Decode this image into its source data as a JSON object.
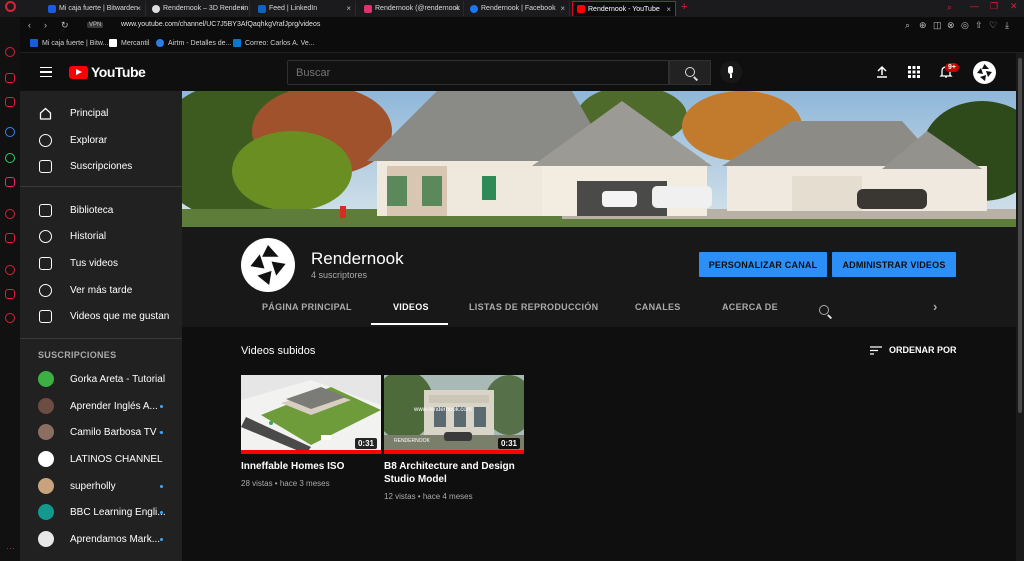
{
  "browser": {
    "tabs": [
      {
        "label": "Mi caja fuerte | Bitwarden",
        "fav_color": "#175ddc"
      },
      {
        "label": "Rendernook – 3D Renderin",
        "fav_color": "#dddddd"
      },
      {
        "label": "Feed | LinkedIn",
        "fav_color": "#0a66c2"
      },
      {
        "label": "Rendernook (@rendernook",
        "fav_color": "#e1306c"
      },
      {
        "label": "Rendernook | Facebook",
        "fav_color": "#1877f2"
      },
      {
        "label": "Rendernook - YouTube",
        "fav_color": "#ff0000"
      }
    ],
    "url": "www.youtube.com/channel/UC7J5BY3AfQaqhkgVrafJprg/videos",
    "vpn_label": "VPN",
    "bookmarks": [
      {
        "label": "Mi caja fuerte | Bitw...",
        "fav_color": "#175ddc"
      },
      {
        "label": "Mercantil",
        "fav_color": "#ffffff"
      },
      {
        "label": "Airtm - Detalles de...",
        "fav_color": "#2d7be5"
      },
      {
        "label": "Correo: Carlos A. Ve...",
        "fav_color": "#0078d4"
      }
    ]
  },
  "header": {
    "logo_text": "YouTube",
    "search_placeholder": "Buscar",
    "notifications_badge": "9+"
  },
  "guide": {
    "main_items": [
      {
        "label": "Principal",
        "icon": "home-icon"
      },
      {
        "label": "Explorar",
        "icon": "compass-icon"
      },
      {
        "label": "Suscripciones",
        "icon": "subscriptions-icon"
      }
    ],
    "library_items": [
      {
        "label": "Biblioteca",
        "icon": "library-icon"
      },
      {
        "label": "Historial",
        "icon": "history-icon"
      },
      {
        "label": "Tus videos",
        "icon": "your-videos-icon"
      },
      {
        "label": "Ver más tarde",
        "icon": "clock-icon"
      },
      {
        "label": "Videos que me gustan",
        "icon": "thumbs-up-icon"
      }
    ],
    "subscriptions_title": "SUSCRIPCIONES",
    "subscriptions": [
      {
        "label": "Gorka Areta - Tutorial...",
        "color": "#3cb043",
        "dot": false
      },
      {
        "label": "Aprender Inglés A...",
        "color": "#6d4c41",
        "dot": true
      },
      {
        "label": "Camilo Barbosa TV - I...",
        "color": "#8d6e63",
        "dot": true
      },
      {
        "label": "LATINOS CHANNEL",
        "color": "#ffffff",
        "dot": false
      },
      {
        "label": "superholly",
        "color": "#c9a27e",
        "dot": true
      },
      {
        "label": "BBC Learning Engli...",
        "color": "#139a8f",
        "dot": true
      },
      {
        "label": "Aprendamos Mark...",
        "color": "#e8e8e8",
        "dot": true
      }
    ]
  },
  "channel": {
    "name": "Rendernook",
    "subscribers": "4 suscriptores",
    "customize_button": "PERSONALIZAR CANAL",
    "manage_button": "ADMINISTRAR VIDEOS",
    "tabs": [
      "PÁGINA PRINCIPAL",
      "VIDEOS",
      "LISTAS DE REPRODUCCIÓN",
      "CANALES",
      "ACERCA DE"
    ],
    "active_tab": "VIDEOS"
  },
  "videos_section": {
    "title": "Videos subidos",
    "sort_label": "ORDENAR POR",
    "videos": [
      {
        "title": "Inneffable Homes ISO",
        "meta": "28 vistas • hace 3 meses",
        "duration": "0:31"
      },
      {
        "title": "B8 Architecture and Design Studio Model",
        "meta": "12 vistas • hace 4 meses",
        "duration": "0:31",
        "watermark": "www.rendernook.com",
        "brand": "RENDERNOOK"
      }
    ]
  },
  "colors": {
    "accent_red": "#ff0000",
    "opera_red": "#d8213a",
    "button_blue": "#2c8ff8",
    "progress_red": "#ff0000"
  }
}
